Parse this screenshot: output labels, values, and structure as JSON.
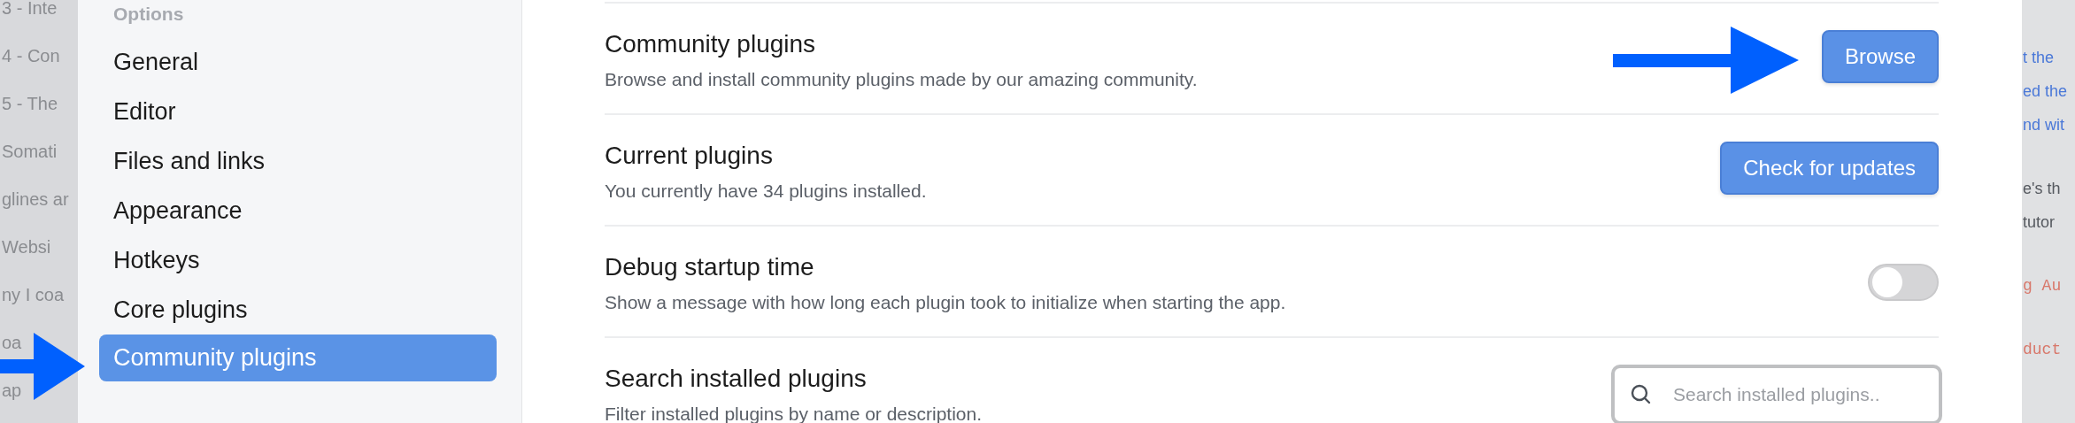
{
  "background_left": {
    "lines": [
      "3 - Inte",
      "4 - Con",
      "5 - The",
      "Somati",
      "glines ar",
      "Websi",
      "ny I coa",
      "oa",
      "ap"
    ]
  },
  "sidebar": {
    "heading": "Options",
    "items": [
      {
        "label": "General",
        "selected": false
      },
      {
        "label": "Editor",
        "selected": false
      },
      {
        "label": "Files and links",
        "selected": false
      },
      {
        "label": "Appearance",
        "selected": false
      },
      {
        "label": "Hotkeys",
        "selected": false
      },
      {
        "label": "Core plugins",
        "selected": false
      },
      {
        "label": "Community plugins",
        "selected": true
      }
    ]
  },
  "settings": [
    {
      "title": "Community plugins",
      "description": "Browse and install community plugins made by our amazing community.",
      "kind": "button",
      "button": "Browse"
    },
    {
      "title": "Current plugins",
      "description": "You currently have 34 plugins installed.",
      "kind": "button",
      "button": "Check for updates"
    },
    {
      "title": "Debug startup time",
      "description": "Show a message with how long each plugin took to initialize when starting the app.",
      "kind": "toggle",
      "on": false
    },
    {
      "title": "Search installed plugins",
      "description": "Filter installed plugins by name or description.",
      "kind": "search",
      "placeholder": "Search installed plugins.."
    }
  ],
  "background_right": {
    "paragraphs": [
      {
        "kind": "link",
        "lines": [
          "t the",
          "ed the",
          "nd wit"
        ]
      },
      {
        "kind": "text",
        "lines": [
          "e's th",
          "tutor"
        ]
      },
      {
        "kind": "code",
        "lines": [
          "g Au"
        ]
      },
      {
        "kind": "code",
        "lines": [
          "duct"
        ]
      }
    ]
  }
}
